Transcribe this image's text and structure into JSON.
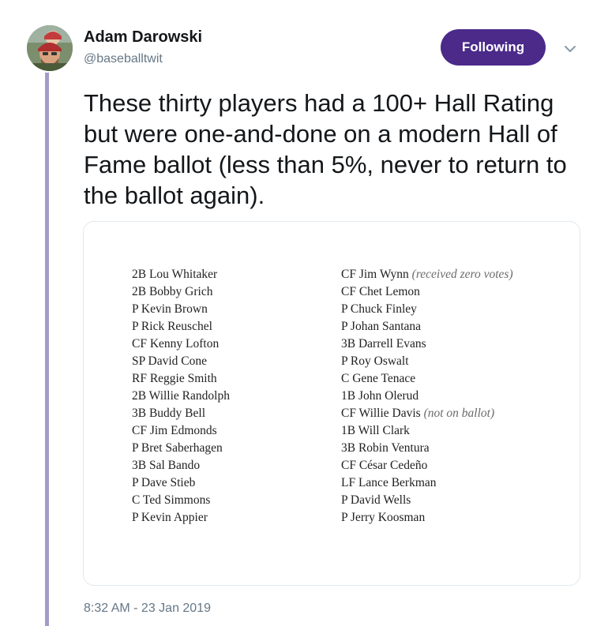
{
  "user": {
    "name": "Adam Darowski",
    "handle": "@baseballtwit"
  },
  "follow_button": {
    "label": "Following"
  },
  "tweet": {
    "text": "These thirty players had a 100+ Hall Rating but were one-and-done on a modern Hall of Fame ballot (less than 5%, never to return to the ballot again).",
    "timestamp": "8:32 AM - 23 Jan 2019"
  },
  "image": {
    "left_column": [
      {
        "name": "2B Lou Whitaker",
        "note": ""
      },
      {
        "name": "2B Bobby Grich",
        "note": ""
      },
      {
        "name": "P Kevin Brown",
        "note": ""
      },
      {
        "name": "P Rick Reuschel",
        "note": ""
      },
      {
        "name": "CF Kenny Lofton",
        "note": ""
      },
      {
        "name": "SP David Cone",
        "note": ""
      },
      {
        "name": "RF Reggie Smith",
        "note": ""
      },
      {
        "name": "2B Willie Randolph",
        "note": ""
      },
      {
        "name": "3B Buddy Bell",
        "note": ""
      },
      {
        "name": "CF Jim Edmonds",
        "note": ""
      },
      {
        "name": "P Bret Saberhagen",
        "note": ""
      },
      {
        "name": "3B Sal Bando",
        "note": ""
      },
      {
        "name": "P Dave Stieb",
        "note": ""
      },
      {
        "name": "C Ted Simmons",
        "note": ""
      },
      {
        "name": "P Kevin Appier",
        "note": ""
      }
    ],
    "right_column": [
      {
        "name": "CF Jim Wynn",
        "note": "(received zero votes)"
      },
      {
        "name": "CF Chet Lemon",
        "note": ""
      },
      {
        "name": "P Chuck Finley",
        "note": ""
      },
      {
        "name": "P Johan Santana",
        "note": ""
      },
      {
        "name": "3B Darrell Evans",
        "note": ""
      },
      {
        "name": "P Roy Oswalt",
        "note": ""
      },
      {
        "name": "C Gene Tenace",
        "note": ""
      },
      {
        "name": "1B John Olerud",
        "note": ""
      },
      {
        "name": "CF Willie Davis",
        "note": "(not on ballot)"
      },
      {
        "name": "1B Will Clark",
        "note": ""
      },
      {
        "name": "3B Robin Ventura",
        "note": ""
      },
      {
        "name": "CF César Cedeño",
        "note": ""
      },
      {
        "name": "LF Lance Berkman",
        "note": ""
      },
      {
        "name": "P David Wells",
        "note": ""
      },
      {
        "name": "P Jerry Koosman",
        "note": ""
      }
    ]
  },
  "icons": {
    "avatar": "user-avatar-photo",
    "caret": "chevron-down-icon"
  },
  "colors": {
    "follow_button_bg": "#4b2a8a",
    "thread_line": "#a59bc9",
    "secondary_text": "#657786"
  }
}
